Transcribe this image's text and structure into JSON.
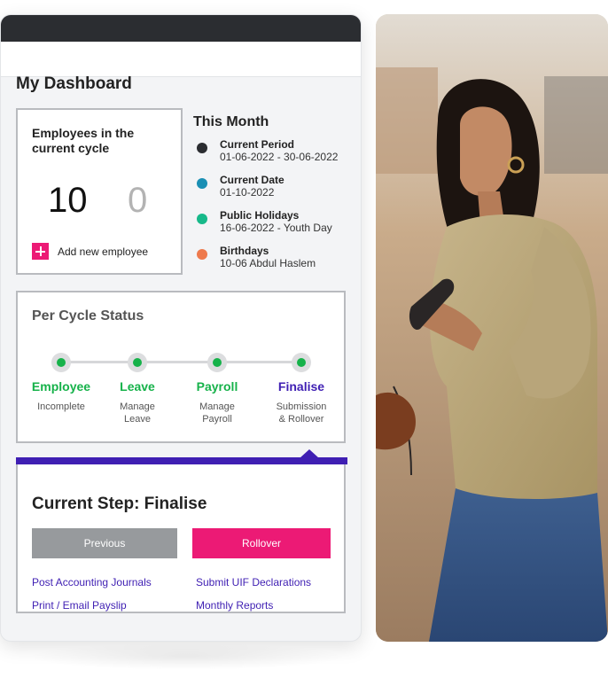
{
  "dashboard": {
    "title": "My Dashboard",
    "employees": {
      "title": "Employees in the current cycle",
      "count": "10",
      "secondary_count": "0",
      "add_label": "Add new employee"
    },
    "this_month": {
      "title": "This Month",
      "items": [
        {
          "label": "Current Period",
          "value": "01-06-2022 - 30-06-2022",
          "color": "#2b2d31"
        },
        {
          "label": "Current Date",
          "value": "01-10-2022",
          "color": "#1a8fb4"
        },
        {
          "label": "Public Holidays",
          "value": "16-06-2022 - Youth Day",
          "color": "#17b98a"
        },
        {
          "label": "Birthdays",
          "value": "10-06 Abdul Haslem",
          "color": "#ee7a4d"
        }
      ]
    },
    "cycle": {
      "title": "Per Cycle Status",
      "steps": [
        {
          "name": "Employee",
          "desc1": "Incomplete",
          "desc2": ""
        },
        {
          "name": "Leave",
          "desc1": "Manage",
          "desc2": "Leave"
        },
        {
          "name": "Payroll",
          "desc1": "Manage",
          "desc2": "Payroll"
        },
        {
          "name": "Finalise",
          "desc1": "Submission",
          "desc2": "& Rollover"
        }
      ]
    },
    "current_step": {
      "title": "Current Step: Finalise",
      "previous_label": "Previous",
      "rollover_label": "Rollover",
      "links": [
        "Post Accounting Journals",
        "Submit UIF Declarations",
        "Print / Email Payslip",
        "Monthly Reports"
      ]
    }
  },
  "colors": {
    "accent_pink": "#ec1a75",
    "accent_purple": "#3f1fb3",
    "status_green": "#16b24a"
  }
}
